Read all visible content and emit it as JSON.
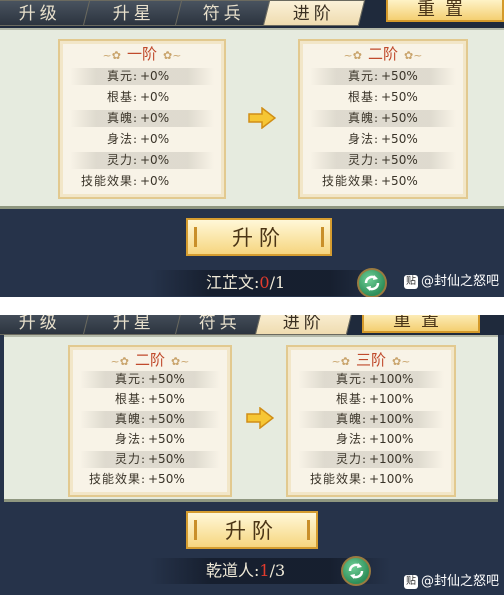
{
  "screens": [
    {
      "tabs": [
        "升级",
        "升星",
        "符兵",
        "进阶"
      ],
      "active_tab": 3,
      "reset_label": "重置",
      "current": {
        "title": "一阶",
        "stats": [
          {
            "name": "真元:",
            "value": "+0%"
          },
          {
            "name": "根基:",
            "value": "+0%"
          },
          {
            "name": "真魄:",
            "value": "+0%"
          },
          {
            "name": "身法:",
            "value": "+0%"
          },
          {
            "name": "灵力:",
            "value": "+0%"
          },
          {
            "name": "技能效果:",
            "value": "+0%"
          }
        ]
      },
      "next": {
        "title": "二阶",
        "stats": [
          {
            "name": "真元:",
            "value": "+50%"
          },
          {
            "name": "根基:",
            "value": "+50%"
          },
          {
            "name": "真魄:",
            "value": "+50%"
          },
          {
            "name": "身法:",
            "value": "+50%"
          },
          {
            "name": "灵力:",
            "value": "+50%"
          },
          {
            "name": "技能效果:",
            "value": "+50%"
          }
        ]
      },
      "upgrade_label": "升阶",
      "cost": {
        "item": "江芷文:",
        "have": "0",
        "need": "/1"
      },
      "watermark": "@封仙之怒吧"
    },
    {
      "tabs": [
        "升级",
        "升星",
        "符兵",
        "进阶"
      ],
      "active_tab": 3,
      "reset_label": "重置",
      "current": {
        "title": "二阶",
        "stats": [
          {
            "name": "真元:",
            "value": "+50%"
          },
          {
            "name": "根基:",
            "value": "+50%"
          },
          {
            "name": "真魄:",
            "value": "+50%"
          },
          {
            "name": "身法:",
            "value": "+50%"
          },
          {
            "name": "灵力:",
            "value": "+50%"
          },
          {
            "name": "技能效果:",
            "value": "+50%"
          }
        ]
      },
      "next": {
        "title": "三阶",
        "stats": [
          {
            "name": "真元:",
            "value": "+100%"
          },
          {
            "name": "根基:",
            "value": "+100%"
          },
          {
            "name": "真魄:",
            "value": "+100%"
          },
          {
            "name": "身法:",
            "value": "+100%"
          },
          {
            "name": "灵力:",
            "value": "+100%"
          },
          {
            "name": "技能效果:",
            "value": "+100%"
          }
        ]
      },
      "upgrade_label": "升阶",
      "cost": {
        "item": "乾道人:",
        "have": "1",
        "need": "/3"
      },
      "watermark": "@封仙之怒吧"
    }
  ],
  "colors": {
    "accent_red": "#e23b2d",
    "title_red": "#c04a2c",
    "button_gold": "#f6d57f",
    "panel_bg": "#26334a"
  },
  "icons": {
    "arrow": "right-arrow-icon",
    "refresh": "refresh-icon",
    "watermark_logo": "tieba-logo-icon"
  }
}
